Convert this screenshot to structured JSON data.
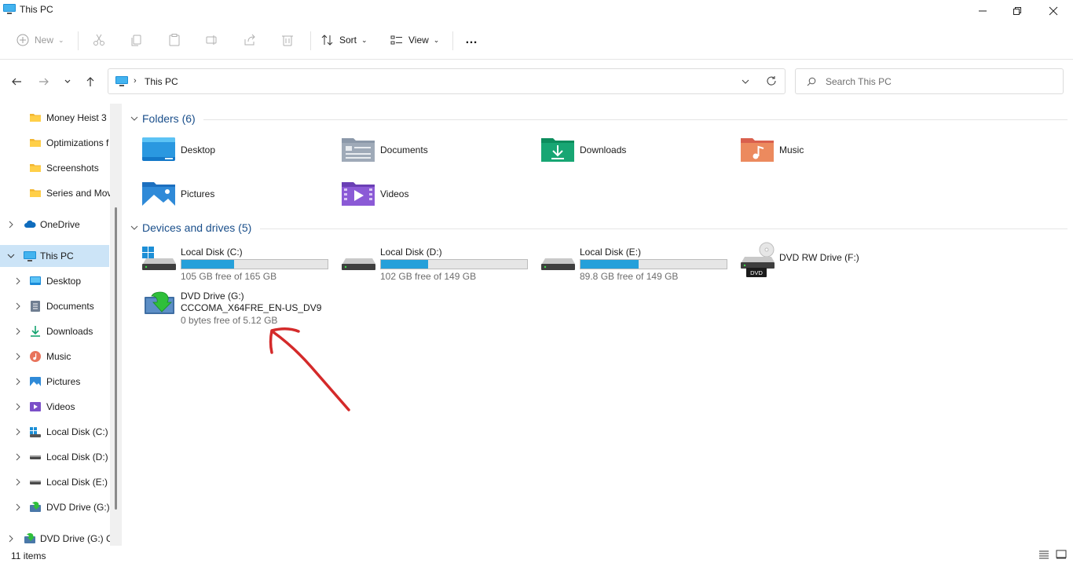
{
  "window": {
    "title": "This PC",
    "icon": "monitor-icon"
  },
  "toolbar": {
    "new_label": "New",
    "sort_label": "Sort",
    "view_label": "View",
    "more_label": "…"
  },
  "navigation": {
    "breadcrumb": [
      "This PC"
    ],
    "search_placeholder": "Search This PC"
  },
  "sidebar": {
    "items": [
      {
        "label": "Money Heist 3",
        "icon": "folder-icon"
      },
      {
        "label": "Optimizations f",
        "icon": "folder-icon"
      },
      {
        "label": "Screenshots",
        "icon": "folder-icon"
      },
      {
        "label": "Series and Mov",
        "icon": "folder-icon"
      },
      {
        "label": "OneDrive",
        "icon": "cloud-icon"
      },
      {
        "label": "This PC",
        "icon": "monitor-icon",
        "selected": true
      },
      {
        "label": "Desktop",
        "icon": "desktop-icon"
      },
      {
        "label": "Documents",
        "icon": "documents-icon"
      },
      {
        "label": "Downloads",
        "icon": "download-icon"
      },
      {
        "label": "Music",
        "icon": "music-icon"
      },
      {
        "label": "Pictures",
        "icon": "pictures-icon"
      },
      {
        "label": "Videos",
        "icon": "videos-icon"
      },
      {
        "label": "Local Disk (C:)",
        "icon": "windows-drive-icon"
      },
      {
        "label": "Local Disk (D:)",
        "icon": "drive-icon"
      },
      {
        "label": "Local Disk (E:)",
        "icon": "drive-icon"
      },
      {
        "label": "DVD Drive (G:) C",
        "icon": "dvd-install-icon"
      },
      {
        "label": "DVD Drive (G:) CC",
        "icon": "dvd-install-icon"
      }
    ]
  },
  "main": {
    "folders_header": "Folders (6)",
    "folders": [
      {
        "label": "Desktop",
        "icon": "desktop-folder-icon"
      },
      {
        "label": "Documents",
        "icon": "documents-folder-icon"
      },
      {
        "label": "Downloads",
        "icon": "downloads-folder-icon"
      },
      {
        "label": "Music",
        "icon": "music-folder-icon"
      },
      {
        "label": "Pictures",
        "icon": "pictures-folder-icon"
      },
      {
        "label": "Videos",
        "icon": "videos-folder-icon"
      }
    ],
    "drives_header": "Devices and drives (5)",
    "drives": [
      {
        "name": "Local Disk (C:)",
        "free": "105 GB free of 165 GB",
        "used_fraction": 0.36,
        "icon": "windows-drive-icon"
      },
      {
        "name": "Local Disk (D:)",
        "free": "102 GB free of 149 GB",
        "used_fraction": 0.32,
        "icon": "drive-icon"
      },
      {
        "name": "Local Disk (E:)",
        "free": "89.8 GB free of 149 GB",
        "used_fraction": 0.4,
        "icon": "drive-icon"
      },
      {
        "name": "DVD RW Drive (F:)",
        "icon": "dvd-rw-drive-icon",
        "badge": "DVD"
      },
      {
        "name": "DVD Drive (G:)",
        "label2": "CCCOMA_X64FRE_EN-US_DV9",
        "free": "0 bytes free of 5.12 GB",
        "icon": "dvd-install-icon"
      }
    ]
  },
  "status": {
    "item_count": "11 items"
  },
  "colors": {
    "accent": "#26a0da",
    "selected": "#cce4f7",
    "header_text": "#1a4f8b",
    "annotation": "#d42a2a"
  }
}
